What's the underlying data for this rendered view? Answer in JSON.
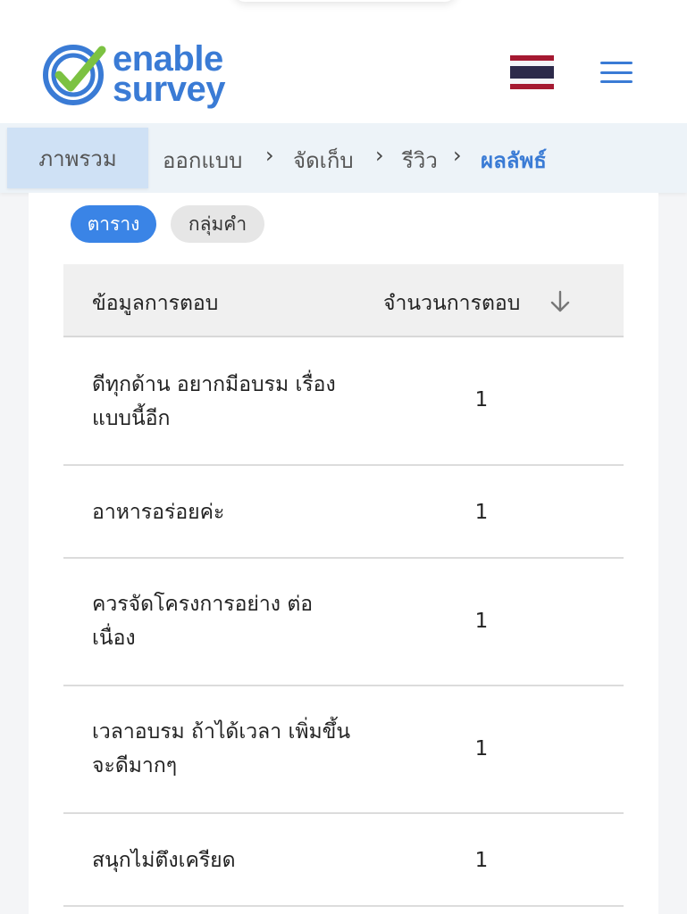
{
  "header": {
    "logo_line1": "enable",
    "logo_line2": "survey",
    "brand_color": "#3a7bd5",
    "check_color": "#7cc242"
  },
  "breadcrumb": {
    "items": [
      {
        "label": "ภาพรวม"
      },
      {
        "label": "ออกแบบ"
      },
      {
        "label": "จัดเก็บ"
      },
      {
        "label": "รีวิว"
      },
      {
        "label": "ผลลัพธ์"
      }
    ],
    "separator": "›"
  },
  "view_toggle": {
    "options": [
      "ตาราง",
      "กลุ่มคำ"
    ],
    "selected": "ตาราง"
  },
  "table": {
    "columns": [
      "ข้อมูลการตอบ",
      "จำนวนการตอบ"
    ],
    "rows": [
      {
        "response": "ดีทุกด้าน อยากมีอบรม เรื่องแบบนี้อีก",
        "count": "1"
      },
      {
        "response": "อาหารอร่อยค่ะ",
        "count": "1"
      },
      {
        "response": "ควรจัดโครงการอย่าง ต่อเนื่อง",
        "count": "1"
      },
      {
        "response": "เวลาอบรม ถ้าได้เวลา เพิ่มขึ้น จะดีมากๆ",
        "count": "1"
      },
      {
        "response": "สนุกไม่ตึงเครียด",
        "count": "1"
      }
    ]
  }
}
